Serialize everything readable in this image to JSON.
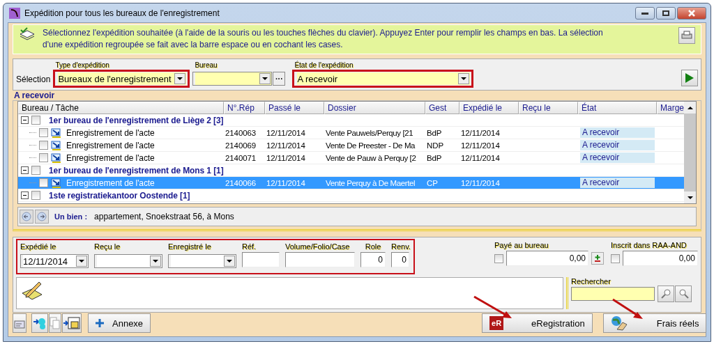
{
  "window": {
    "title": "Expédition pour tous les bureaux de l'enregistrement"
  },
  "banner": {
    "text": "Sélectionnez l'expédition souhaitée (à l'aide de la souris ou les touches flèches du clavier). Appuyez Enter pour remplir les champs en bas. La sélection d'une expédition regroupée se fait avec la barre espace ou en cochant les cases."
  },
  "selection": {
    "label": "Sélection",
    "fields": [
      {
        "label": "Type d'expédition",
        "value": "Bureaux de l'enregistrement",
        "highlighted": true
      },
      {
        "label": "Bureau",
        "highlighted": false,
        "browse": "···"
      },
      {
        "label": "État de l'expédition",
        "value": "A recevoir",
        "highlighted": true
      }
    ]
  },
  "group_title": "A recevoir",
  "table": {
    "columns": [
      "Bureau / Tâche",
      "N°.Rép",
      "Passé le",
      "Dossier",
      "Gest",
      "Expédié le",
      "Reçu le",
      "État",
      "Marge"
    ],
    "groups": [
      {
        "label": "1er bureau de l'enregistrement de Liège 2 [3]",
        "expanded": true,
        "checked": false,
        "rows": [
          {
            "task": "Enregistrement de l'acte",
            "ref": "2140063",
            "passed": "12/11/2014",
            "dossier": "Vente Pauwels/Perquy [21",
            "gest": "BdP",
            "sent": "12/11/2014",
            "status": "A recevoir",
            "checked": false,
            "selected": false
          },
          {
            "task": "Enregistrement de l'acte",
            "ref": "2140069",
            "passed": "12/11/2014",
            "dossier": "Vente De Preester - De Ma",
            "gest": "NDP",
            "sent": "12/11/2014",
            "status": "A recevoir",
            "checked": false,
            "selected": false
          },
          {
            "task": "Enregistrement de l'acte",
            "ref": "2140071",
            "passed": "12/11/2014",
            "dossier": "Vente de Pauw à Perquy [2",
            "gest": "BdP",
            "sent": "12/11/2014",
            "status": "A recevoir",
            "checked": false,
            "selected": false
          }
        ]
      },
      {
        "label": "1er bureau de l'enregistrement de Mons 1 [1]",
        "expanded": true,
        "checked": false,
        "rows": [
          {
            "task": "Enregistrement de l'acte",
            "ref": "2140066",
            "passed": "12/11/2014",
            "dossier": "Vente Perquy à De Maertel",
            "gest": "CP",
            "sent": "12/11/2014",
            "status": "A recevoir",
            "checked": false,
            "selected": true
          }
        ]
      },
      {
        "label": "1ste registratiekantoor Oostende [1]",
        "expanded": true,
        "checked": false
      }
    ]
  },
  "detail": {
    "label": "Un bien :",
    "value": "appartement, Snoekstraat 56, à Mons"
  },
  "form": {
    "highlighted": true,
    "fields": [
      {
        "label": "Expédié le",
        "value": "12/11/2014",
        "kind": "date"
      },
      {
        "label": "Reçu le",
        "kind": "date"
      },
      {
        "label": "Enregistré le",
        "kind": "date"
      },
      {
        "label": "Réf.",
        "kind": "text"
      },
      {
        "label": "Volume/Folio/Case",
        "kind": "text"
      },
      {
        "label": "Role",
        "value": "0",
        "kind": "number"
      },
      {
        "label": "Renv.",
        "value": "0",
        "kind": "number"
      }
    ],
    "amounts": [
      {
        "label": "Payé au bureau",
        "value": "0,00",
        "checked": false,
        "kind": "adjust"
      },
      {
        "label": "Inscrit dans RAA-AND",
        "value": "0,00",
        "checked": false,
        "kind": "plain"
      }
    ]
  },
  "search": {
    "label": "Rechercher"
  },
  "buttons": {
    "annexe": "Annexe",
    "eregistration": {
      "logo": "eR",
      "label": "eRegistration"
    },
    "frais": "Frais réels"
  }
}
